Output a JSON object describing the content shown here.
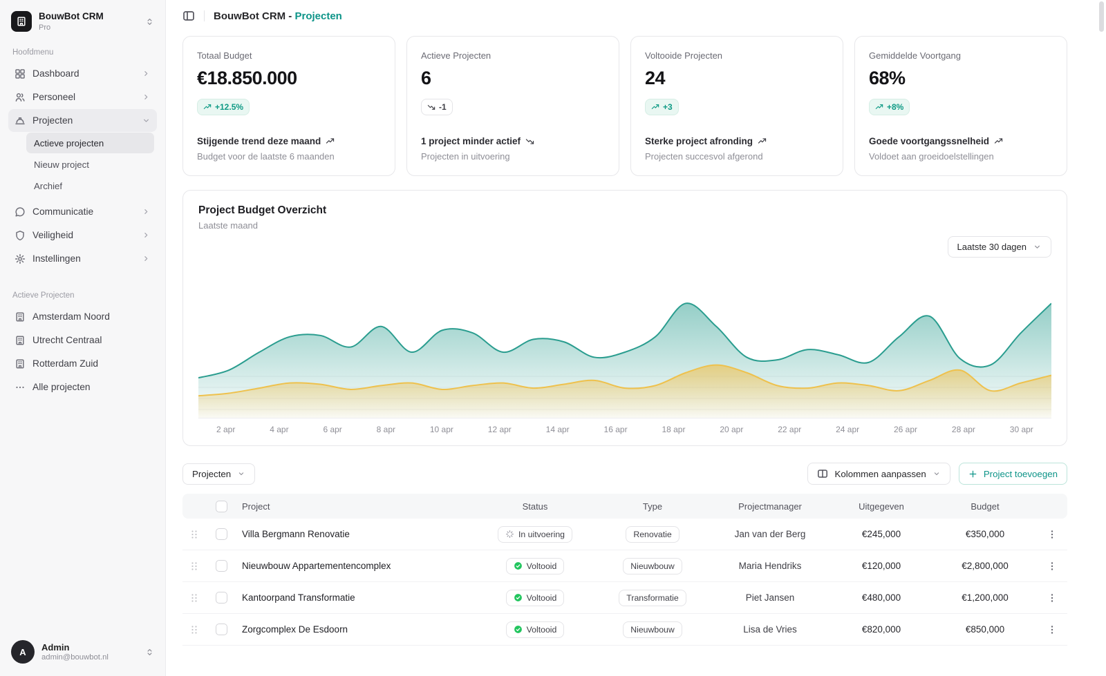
{
  "colors": {
    "accent": "#0d9488",
    "badge_positive_bg": "#e9f7f2",
    "status_done_green": "#22c55e",
    "chart_teal": "#2a9d8f",
    "chart_amber": "#eec14d",
    "sidebar_bg": "#f7f7f8"
  },
  "icons": {
    "brand": "building-icon",
    "sidebar_toggle": "panel-left-icon",
    "workspace_switch": "chevron-up-down-icon",
    "trend_positive": "trending-up-icon",
    "trend_negative": "trending-down-icon",
    "status_in_progress": "loader-spinner-icon",
    "status_done": "check-circle-icon",
    "row_menu": "kebab-menu-icon",
    "row_drag": "drag-handle-icon",
    "columns": "columns-icon",
    "add": "plus-icon"
  },
  "workspace": {
    "brand": "BouwBot CRM",
    "plan": "Pro"
  },
  "topbar": {
    "title_prefix": "BouwBot CRM -",
    "title_current": "Projecten"
  },
  "sidebar": {
    "section_main": "Hoofdmenu",
    "menu": [
      {
        "label": "Dashboard"
      },
      {
        "label": "Personeel"
      },
      {
        "label": "Projecten"
      },
      {
        "label": "Communicatie"
      },
      {
        "label": "Veiligheid"
      },
      {
        "label": "Instellingen"
      }
    ],
    "projecten_sub": [
      {
        "label": "Actieve projecten"
      },
      {
        "label": "Nieuw project"
      },
      {
        "label": "Archief"
      }
    ],
    "section_projects": "Actieve Projecten",
    "projects": [
      {
        "label": "Amsterdam Noord"
      },
      {
        "label": "Utrecht Centraal"
      },
      {
        "label": "Rotterdam Zuid"
      }
    ],
    "all_projects": "Alle projecten",
    "user": {
      "initial": "A",
      "name": "Admin",
      "email": "admin@bouwbot.nl"
    }
  },
  "stats": [
    {
      "title": "Totaal Budget",
      "value": "€18.850.000",
      "badge": "+12.5%",
      "trend": "up",
      "line1": "Stijgende trend deze maand",
      "line2": "Budget voor de laatste 6 maanden"
    },
    {
      "title": "Actieve Projecten",
      "value": "6",
      "badge": "-1",
      "trend": "down",
      "line1": "1 project minder actief",
      "line2": "Projecten in uitvoering"
    },
    {
      "title": "Voltooide Projecten",
      "value": "24",
      "badge": "+3",
      "trend": "up",
      "line1": "Sterke project afronding",
      "line2": "Projecten succesvol afgerond"
    },
    {
      "title": "Gemiddelde Voortgang",
      "value": "68%",
      "badge": "+8%",
      "trend": "up",
      "line1": "Goede voortgangssnelheid",
      "line2": "Voldoet aan groeidoelstellingen"
    }
  ],
  "chart": {
    "title": "Project Budget Overzicht",
    "subtitle": "Laatste maand",
    "range_label": "Laatste 30 dagen",
    "chart_data": {
      "type": "area",
      "x": [
        "2 apr",
        "4 apr",
        "6 apr",
        "8 apr",
        "10 apr",
        "12 apr",
        "14 apr",
        "16 apr",
        "18 apr",
        "20 apr",
        "22 apr",
        "24 apr",
        "26 apr",
        "28 apr",
        "30 apr"
      ],
      "y_range": [
        0,
        100
      ],
      "grid": "light-horizontal",
      "legend": "none",
      "series": [
        {
          "name": "series_teal",
          "color": "#2a9d8f",
          "values": [
            30,
            36,
            50,
            62,
            63,
            54,
            70,
            50,
            67,
            65,
            50,
            60,
            58,
            46,
            50,
            62,
            88,
            70,
            46,
            44,
            52,
            48,
            42,
            62,
            78,
            45,
            40,
            65,
            88
          ]
        },
        {
          "name": "series_amber",
          "color": "#eec14d",
          "values": [
            16,
            18,
            22,
            26,
            25,
            21,
            24,
            26,
            21,
            24,
            26,
            22,
            25,
            28,
            22,
            24,
            34,
            40,
            34,
            24,
            22,
            26,
            24,
            20,
            28,
            36,
            20,
            26,
            32
          ]
        }
      ]
    }
  },
  "toolbar": {
    "scope": "Projecten",
    "columns": "Kolommen aanpassen",
    "add": "Project toevoegen"
  },
  "table": {
    "headers": [
      "Project",
      "Status",
      "Type",
      "Projectmanager",
      "Uitgegeven",
      "Budget"
    ],
    "rows": [
      {
        "project": "Villa Bergmann Renovatie",
        "status": "In uitvoering",
        "status_kind": "in-progress",
        "type": "Renovatie",
        "manager": "Jan van der Berg",
        "spent": "€245,000",
        "budget": "€350,000"
      },
      {
        "project": "Nieuwbouw Appartementencomplex",
        "status": "Voltooid",
        "status_kind": "done",
        "type": "Nieuwbouw",
        "manager": "Maria Hendriks",
        "spent": "€120,000",
        "budget": "€2,800,000"
      },
      {
        "project": "Kantoorpand Transformatie",
        "status": "Voltooid",
        "status_kind": "done",
        "type": "Transformatie",
        "manager": "Piet Jansen",
        "spent": "€480,000",
        "budget": "€1,200,000"
      },
      {
        "project": "Zorgcomplex De Esdoorn",
        "status": "Voltooid",
        "status_kind": "done",
        "type": "Nieuwbouw",
        "manager": "Lisa de Vries",
        "spent": "€820,000",
        "budget": "€850,000"
      }
    ]
  }
}
